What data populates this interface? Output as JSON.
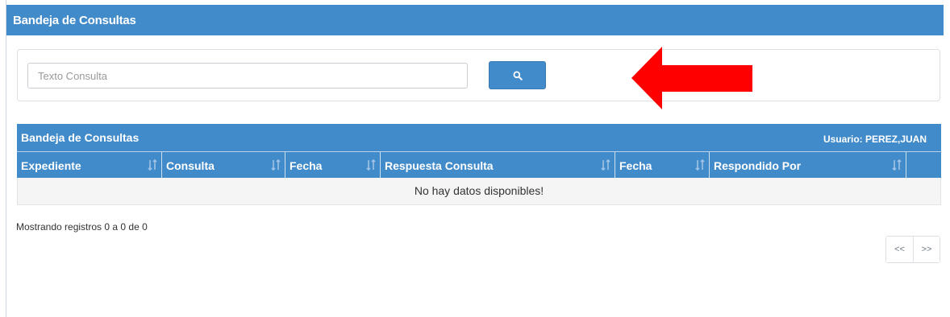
{
  "header": {
    "title": "Bandeja de Consultas"
  },
  "search": {
    "placeholder": "Texto Consulta",
    "value": "",
    "button_icon": "search-icon"
  },
  "annotation": {
    "icon": "left-arrow",
    "color": "#ff0000"
  },
  "grid": {
    "title": "Bandeja de Consultas",
    "user_label": "Usuario: PEREZ,JUAN",
    "columns": [
      "Expediente",
      "Consulta",
      "Fecha",
      "Respuesta Consulta",
      "Fecha",
      "Respondido Por"
    ],
    "empty_message": "No hay datos disponibles!"
  },
  "footer": {
    "records_info": "Mostrando registros 0 a 0 de 0"
  },
  "pagination": {
    "prev_label": "<<",
    "next_label": ">>"
  },
  "colors": {
    "header": "#428bca",
    "arrow": "#ff0000"
  }
}
